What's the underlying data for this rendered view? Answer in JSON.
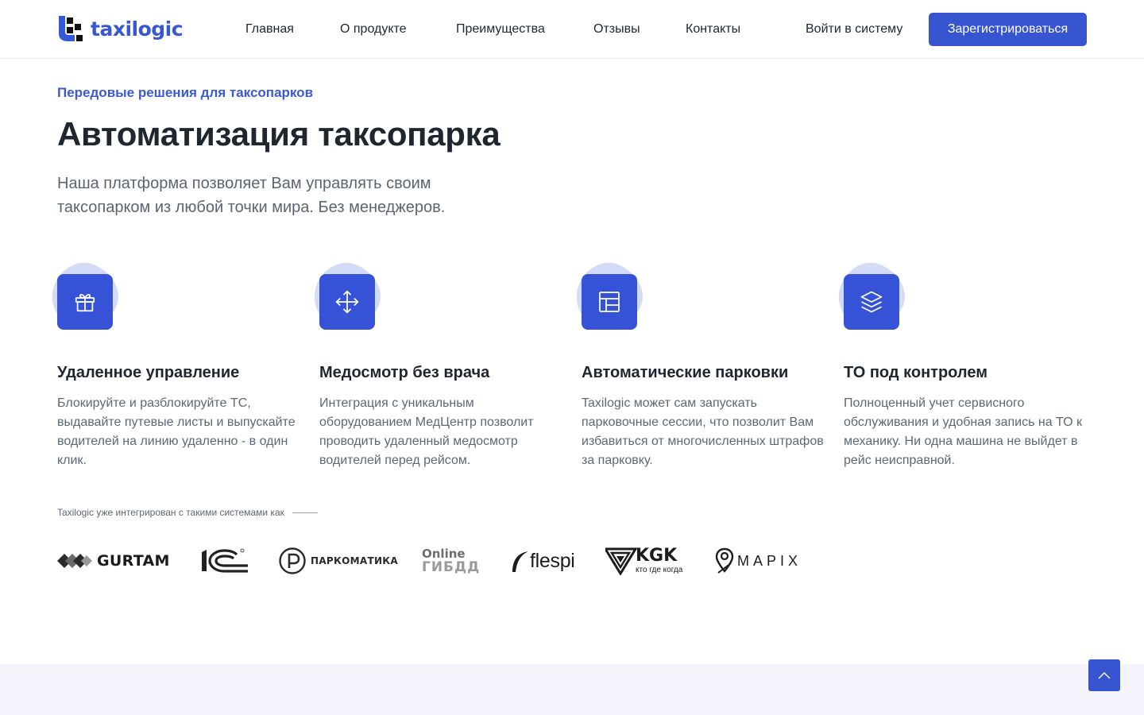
{
  "header": {
    "logo_text": "taxilogic",
    "nav": [
      {
        "label": "Главная"
      },
      {
        "label": "О продукте"
      },
      {
        "label": "Преимущества"
      },
      {
        "label": "Отзывы"
      },
      {
        "label": "Контакты"
      }
    ],
    "login_label": "Войти в систему",
    "register_label": "Зарегистрироваться"
  },
  "hero": {
    "eyebrow": "Передовые решения для таксопарков",
    "title": "Автоматизация таксопарка",
    "subtitle": "Наша платформа позволяет Вам управлять своим таксопарком из любой точки мира. Без менеджеров."
  },
  "features": [
    {
      "icon": "gift-icon",
      "title": "Удаленное управление",
      "text": "Блокируйте и разблокируйте ТС, выдавайте путевые листы и выпускайте водителей на линию удаленно - в один клик."
    },
    {
      "icon": "move-arrows-icon",
      "title": "Медосмотр без врача",
      "text": "Интеграция с уникальным оборудованием МедЦентр позволит проводить удаленный медосмотр водителей перед рейсом."
    },
    {
      "icon": "layout-icon",
      "title": "Автоматические парковки",
      "text": "Taxilogic может сам запускать парковочные сессии, что позволит Вам избавиться от многочисленных штрафов за парковку."
    },
    {
      "icon": "layers-icon",
      "title": "ТО под контролем",
      "text": "Полноценный учет сервисного обслуживания и удобная запись на ТО к механику. Ни одна машина не выйдет в рейс неисправной."
    }
  ],
  "integrations": {
    "label": "Taxilogic уже интегрирован с такими системами как",
    "partners": [
      {
        "name": "gurtam-logo",
        "text": "GURTAM"
      },
      {
        "name": "1c-logo",
        "text": "1C"
      },
      {
        "name": "parkomatika-logo",
        "text": "ПАРКОМАТИКА"
      },
      {
        "name": "online-gibdd-logo",
        "line1": "Online",
        "line2": "ГИБДД"
      },
      {
        "name": "flespi-logo",
        "text": "flespi"
      },
      {
        "name": "kgk-logo",
        "text": "KGK",
        "subtext": "кто где когда"
      },
      {
        "name": "mapix-logo",
        "text": "MAPIX"
      }
    ]
  },
  "colors": {
    "accent": "#3755d1",
    "text_dark": "#1f2630",
    "text_muted": "#5f6775",
    "band": "#f4f5fc"
  }
}
